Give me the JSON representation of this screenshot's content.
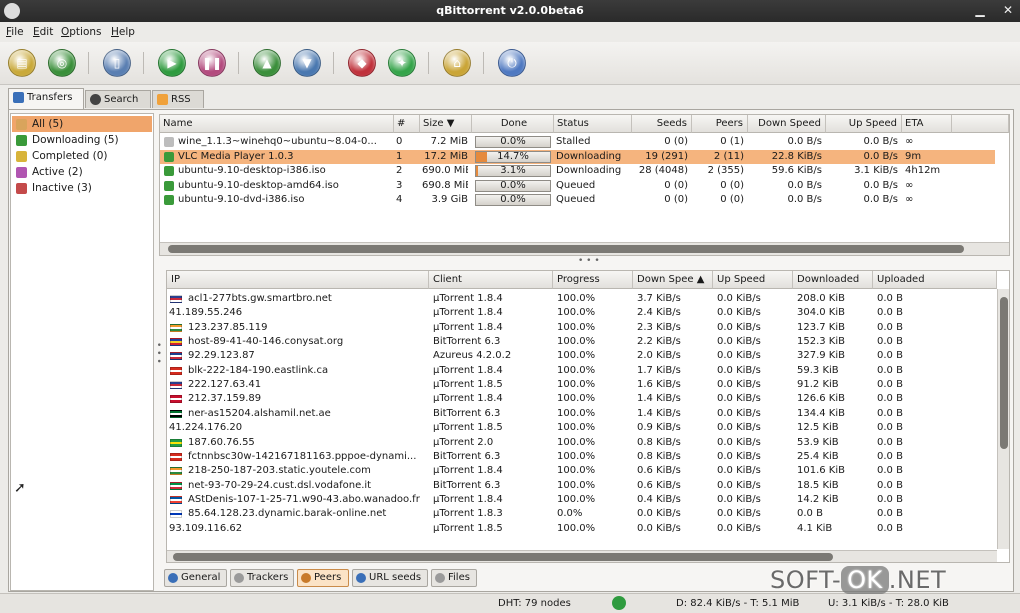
{
  "window": {
    "title": "qBittorrent v2.0.0beta6"
  },
  "menu": [
    "File",
    "Edit",
    "Options",
    "Help"
  ],
  "toolbar": [
    {
      "name": "add-torrent-button",
      "icon": "folder-icon",
      "color": "#c9a93a",
      "glyph": "▤"
    },
    {
      "name": "add-url-button",
      "icon": "globe-icon",
      "color": "#3a8f3a",
      "glyph": "◎"
    },
    {
      "name": "delete-button",
      "icon": "trash-icon",
      "color": "#5a7fb2",
      "glyph": "▯"
    },
    {
      "name": "resume-button",
      "icon": "play-icon",
      "color": "#2f9b3f",
      "glyph": "▶"
    },
    {
      "name": "pause-button",
      "icon": "pause-icon",
      "color": "#b34b7e",
      "glyph": "❚❚"
    },
    {
      "name": "increase-priority-button",
      "icon": "arrow-up-icon",
      "color": "#3b8f3b",
      "glyph": "▲"
    },
    {
      "name": "decrease-priority-button",
      "icon": "arrow-down-icon",
      "color": "#4a78b0",
      "glyph": "▼"
    },
    {
      "name": "search-button",
      "icon": "magnet-icon",
      "color": "#c0323c",
      "glyph": "◆"
    },
    {
      "name": "create-torrent-button",
      "icon": "create-icon",
      "color": "#35a44a",
      "glyph": "✦"
    },
    {
      "name": "options-button",
      "icon": "lock-icon",
      "color": "#caa537",
      "glyph": "⌂"
    },
    {
      "name": "power-button",
      "icon": "power-icon",
      "color": "#4f79c1",
      "glyph": "⏻"
    }
  ],
  "tabs": [
    "Transfers",
    "Search",
    "RSS"
  ],
  "filters": [
    {
      "label": "All (5)",
      "color": "#d9a45c",
      "selected": true
    },
    {
      "label": "Downloading (5)",
      "color": "#3a9a3a",
      "selected": false
    },
    {
      "label": "Completed (0)",
      "color": "#d8b43a",
      "selected": false
    },
    {
      "label": "Active (2)",
      "color": "#b155b1",
      "selected": false
    },
    {
      "label": "Inactive (3)",
      "color": "#c44a4a",
      "selected": false
    }
  ],
  "torrent_headers": [
    "Name",
    "#",
    "Size ▼",
    "Done",
    "Status",
    "Seeds",
    "Peers",
    "Down Speed",
    "Up Speed",
    "ETA"
  ],
  "torrents": [
    {
      "name": "wine_1.1.3~winehq0~ubuntu~8.04-0...",
      "num": "0",
      "size": "7.2 MiB",
      "done": "0.0%",
      "done_frac": 0.0,
      "status": "Stalled",
      "seeds": "0 (0)",
      "peers": "0 (1)",
      "down": "0.0 B/s",
      "up": "0.0 B/s",
      "eta": "∞",
      "selected": false
    },
    {
      "name": "VLC Media Player 1.0.3",
      "num": "1",
      "size": "17.2 MiB",
      "done": "14.7%",
      "done_frac": 0.147,
      "status": "Downloading",
      "seeds": "19 (291)",
      "peers": "2 (11)",
      "down": "22.8 KiB/s",
      "up": "0.0 B/s",
      "eta": "9m",
      "selected": true
    },
    {
      "name": "ubuntu-9.10-desktop-i386.iso",
      "num": "2",
      "size": "690.0 MiB",
      "done": "3.1%",
      "done_frac": 0.031,
      "status": "Downloading",
      "seeds": "28 (4048)",
      "peers": "2 (355)",
      "down": "59.6 KiB/s",
      "up": "3.1 KiB/s",
      "eta": "4h12m",
      "selected": false
    },
    {
      "name": "ubuntu-9.10-desktop-amd64.iso",
      "num": "3",
      "size": "690.8 MiB",
      "done": "0.0%",
      "done_frac": 0.0,
      "status": "Queued",
      "seeds": "0 (0)",
      "peers": "0 (0)",
      "down": "0.0 B/s",
      "up": "0.0 B/s",
      "eta": "∞",
      "selected": false
    },
    {
      "name": "ubuntu-9.10-dvd-i386.iso",
      "num": "4",
      "size": "3.9 GiB",
      "done": "0.0%",
      "done_frac": 0.0,
      "status": "Queued",
      "seeds": "0 (0)",
      "peers": "0 (0)",
      "down": "0.0 B/s",
      "up": "0.0 B/s",
      "eta": "∞",
      "selected": false
    }
  ],
  "peer_headers": [
    "IP",
    "Client",
    "Progress",
    "Down Spee ▲",
    "Up Speed",
    "Downloaded",
    "Uploaded"
  ],
  "peers": [
    {
      "ip": "acl1-277bts.gw.smartbro.net",
      "flag": [
        "#2a3f8f",
        "#c8283b",
        "#ffffff"
      ],
      "client": "µTorrent 1.8.4",
      "progress": "100.0%",
      "down": "3.7 KiB/s",
      "up": "0.0 KiB/s",
      "downloaded": "208.0 KiB",
      "uploaded": "0.0 B"
    },
    {
      "ip": "41.189.55.246",
      "flag": null,
      "client": "µTorrent 1.8.4",
      "progress": "100.0%",
      "down": "2.4 KiB/s",
      "up": "0.0 KiB/s",
      "downloaded": "304.0 KiB",
      "uploaded": "0.0 B"
    },
    {
      "ip": "123.237.85.119",
      "flag": [
        "#f29a2e",
        "#ffffff",
        "#2b8a3e"
      ],
      "client": "µTorrent 1.8.4",
      "progress": "100.0%",
      "down": "2.3 KiB/s",
      "up": "0.0 KiB/s",
      "downloaded": "123.7 KiB",
      "uploaded": "0.0 B"
    },
    {
      "ip": "host-89-41-40-146.conysat.org",
      "flag": [
        "#2140a0",
        "#f5d028",
        "#cf2030"
      ],
      "client": "BitTorrent 6.3",
      "progress": "100.0%",
      "down": "2.2 KiB/s",
      "up": "0.0 KiB/s",
      "downloaded": "152.3 KiB",
      "uploaded": "0.0 B"
    },
    {
      "ip": "92.29.123.87",
      "flag": [
        "#1f3f8f",
        "#ffffff",
        "#c8283b"
      ],
      "client": "Azureus 4.2.0.2",
      "progress": "100.0%",
      "down": "2.0 KiB/s",
      "up": "0.0 KiB/s",
      "downloaded": "327.9 KiB",
      "uploaded": "0.0 B"
    },
    {
      "ip": "blk-222-184-190.eastlink.ca",
      "flag": [
        "#d52b1e",
        "#ffffff",
        "#d52b1e"
      ],
      "client": "µTorrent 1.8.4",
      "progress": "100.0%",
      "down": "1.7 KiB/s",
      "up": "0.0 KiB/s",
      "downloaded": "59.3 KiB",
      "uploaded": "0.0 B"
    },
    {
      "ip": "222.127.63.41",
      "flag": [
        "#2a3f8f",
        "#c8283b",
        "#ffffff"
      ],
      "client": "µTorrent 1.8.5",
      "progress": "100.0%",
      "down": "1.6 KiB/s",
      "up": "0.0 KiB/s",
      "downloaded": "91.2 KiB",
      "uploaded": "0.0 B"
    },
    {
      "ip": "212.37.159.89",
      "flag": [
        "#c8102e",
        "#ffffff",
        "#c8102e"
      ],
      "client": "µTorrent 1.8.4",
      "progress": "100.0%",
      "down": "1.4 KiB/s",
      "up": "0.0 KiB/s",
      "downloaded": "126.6 KiB",
      "uploaded": "0.0 B"
    },
    {
      "ip": "ner-as15204.alshamil.net.ae",
      "flag": [
        "#00732f",
        "#ffffff",
        "#000000"
      ],
      "client": "BitTorrent 6.3",
      "progress": "100.0%",
      "down": "1.4 KiB/s",
      "up": "0.0 KiB/s",
      "downloaded": "134.4 KiB",
      "uploaded": "0.0 B"
    },
    {
      "ip": "41.224.176.20",
      "flag": null,
      "client": "µTorrent 1.8.5",
      "progress": "100.0%",
      "down": "0.9 KiB/s",
      "up": "0.0 KiB/s",
      "downloaded": "12.5 KiB",
      "uploaded": "0.0 B"
    },
    {
      "ip": "187.60.76.55",
      "flag": [
        "#229e45",
        "#f8e509",
        "#229e45"
      ],
      "client": "µTorrent 2.0",
      "progress": "100.0%",
      "down": "0.8 KiB/s",
      "up": "0.0 KiB/s",
      "downloaded": "53.9 KiB",
      "uploaded": "0.0 B"
    },
    {
      "ip": "fctnnbsc30w-142167181163.pppoe-dynami...",
      "flag": [
        "#d52b1e",
        "#ffffff",
        "#d52b1e"
      ],
      "client": "BitTorrent 6.3",
      "progress": "100.0%",
      "down": "0.8 KiB/s",
      "up": "0.0 KiB/s",
      "downloaded": "25.4 KiB",
      "uploaded": "0.0 B"
    },
    {
      "ip": "218-250-187-203.static.youtele.com",
      "flag": [
        "#f29a2e",
        "#ffffff",
        "#2b8a3e"
      ],
      "client": "µTorrent 1.8.4",
      "progress": "100.0%",
      "down": "0.6 KiB/s",
      "up": "0.0 KiB/s",
      "downloaded": "101.6 KiB",
      "uploaded": "0.0 B"
    },
    {
      "ip": "net-93-70-29-24.cust.dsl.vodafone.it",
      "flag": [
        "#009246",
        "#ffffff",
        "#ce2b37"
      ],
      "client": "BitTorrent 6.3",
      "progress": "100.0%",
      "down": "0.6 KiB/s",
      "up": "0.0 KiB/s",
      "downloaded": "18.5 KiB",
      "uploaded": "0.0 B"
    },
    {
      "ip": "AStDenis-107-1-25-71.w90-43.abo.wanadoo.fr",
      "flag": [
        "#0055a4",
        "#ffffff",
        "#ef4135"
      ],
      "client": "µTorrent 1.8.4",
      "progress": "100.0%",
      "down": "0.4 KiB/s",
      "up": "0.0 KiB/s",
      "downloaded": "14.2 KiB",
      "uploaded": "0.0 B"
    },
    {
      "ip": "85.64.128.23.dynamic.barak-online.net",
      "flag": [
        "#ffffff",
        "#0038b8",
        "#ffffff"
      ],
      "client": "µTorrent 1.8.3",
      "progress": "0.0%",
      "down": "0.0 KiB/s",
      "up": "0.0 KiB/s",
      "downloaded": "0.0 B",
      "uploaded": "0.0 B"
    },
    {
      "ip": "93.109.116.62",
      "flag": null,
      "client": "µTorrent 1.8.5",
      "progress": "100.0%",
      "down": "0.0 KiB/s",
      "up": "0.0 KiB/s",
      "downloaded": "4.1 KiB",
      "uploaded": "0.0 B"
    }
  ],
  "bottom_tabs": [
    {
      "label": "General",
      "color": "#3a6fb8",
      "active": false
    },
    {
      "label": "Trackers",
      "color": "#9a9a9a",
      "active": false
    },
    {
      "label": "Peers",
      "color": "#c87a2a",
      "active": true
    },
    {
      "label": "URL seeds",
      "color": "#3a6fb8",
      "active": false
    },
    {
      "label": "Files",
      "color": "#9a9a9a",
      "active": false
    }
  ],
  "status": {
    "dht": "DHT: 79 nodes",
    "down": "D: 82.4 KiB/s - T: 5.1 MiB",
    "up": "U: 3.1 KiB/s - T: 28.0 KiB"
  },
  "watermark": {
    "a": "SOFT-",
    "ok": "OK",
    "b": ".NET"
  }
}
